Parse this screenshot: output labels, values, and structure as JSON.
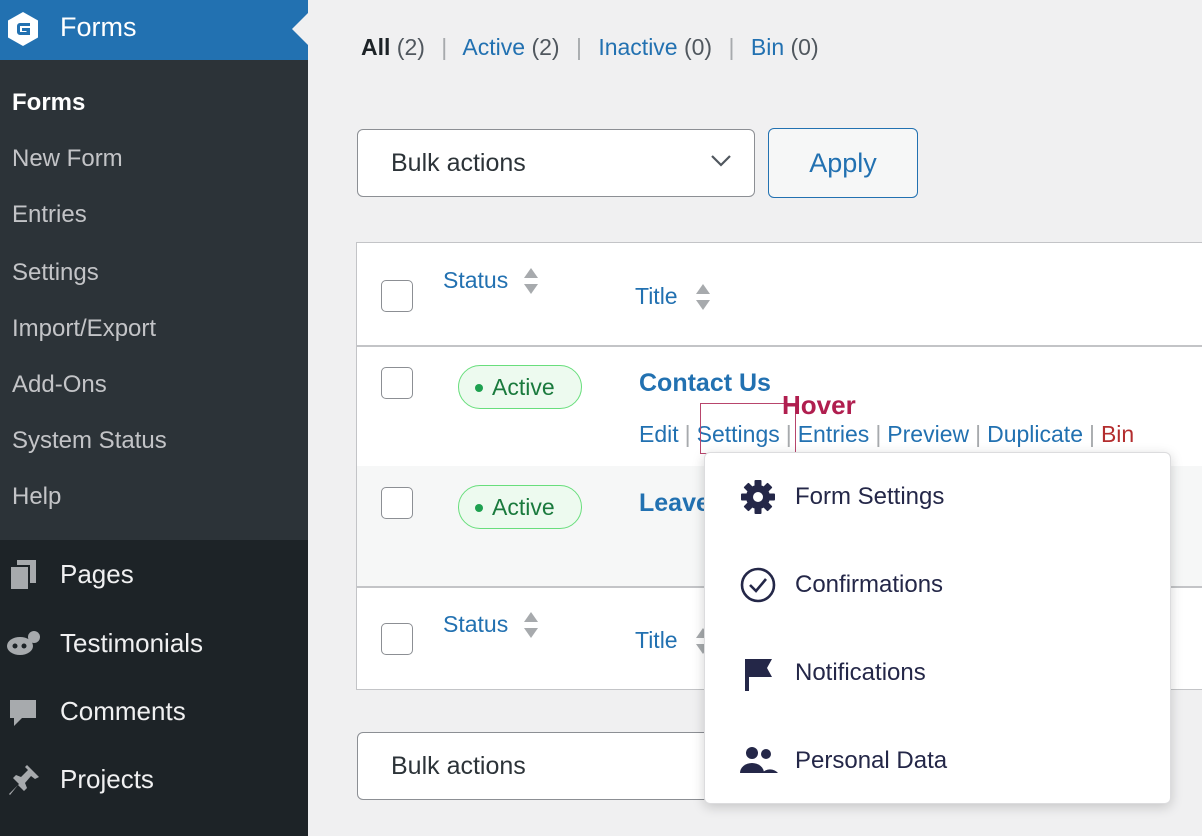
{
  "sidebar": {
    "header_title": "Forms",
    "submenu": [
      {
        "label": "Forms",
        "current": true
      },
      {
        "label": "New Form"
      },
      {
        "label": "Entries"
      },
      {
        "label": "Settings"
      },
      {
        "label": "Import/Export"
      },
      {
        "label": "Add-Ons"
      },
      {
        "label": "System Status"
      },
      {
        "label": "Help"
      }
    ],
    "menu": [
      {
        "label": "Pages",
        "icon": "pages-icon"
      },
      {
        "label": "Testimonials",
        "icon": "testimonials-icon"
      },
      {
        "label": "Comments",
        "icon": "comments-icon"
      },
      {
        "label": "Projects",
        "icon": "pin-icon"
      }
    ]
  },
  "filters": {
    "all": {
      "label": "All",
      "count": "(2)"
    },
    "active": {
      "label": "Active",
      "count": "(2)"
    },
    "inactive": {
      "label": "Inactive",
      "count": "(0)"
    },
    "bin": {
      "label": "Bin",
      "count": "(0)"
    },
    "separator": "|"
  },
  "bulk_actions": {
    "label": "Bulk actions",
    "apply_label": "Apply"
  },
  "table": {
    "columns": {
      "status": "Status",
      "title": "Title"
    },
    "rows": [
      {
        "status": "Active",
        "title": "Contact Us"
      },
      {
        "status": "Active",
        "title": "Leave"
      }
    ],
    "row_actions": {
      "edit": "Edit",
      "settings": "Settings",
      "entries": "Entries",
      "preview": "Preview",
      "duplicate": "Duplicate",
      "bin": "Bin",
      "separator": "|"
    }
  },
  "annotation": {
    "hover_label": "Hover"
  },
  "settings_dropdown": {
    "items": [
      {
        "label": "Form Settings",
        "icon": "gear-icon"
      },
      {
        "label": "Confirmations",
        "icon": "check-circle-icon"
      },
      {
        "label": "Notifications",
        "icon": "flag-icon"
      },
      {
        "label": "Personal Data",
        "icon": "people-icon"
      }
    ]
  },
  "colors": {
    "sidebar_bg": "#1d2327",
    "submenu_bg": "#2c3338",
    "accent": "#2271b1",
    "active_badge": "#68de7c",
    "danger": "#b32d2e",
    "annotation": "#b01e4f"
  }
}
